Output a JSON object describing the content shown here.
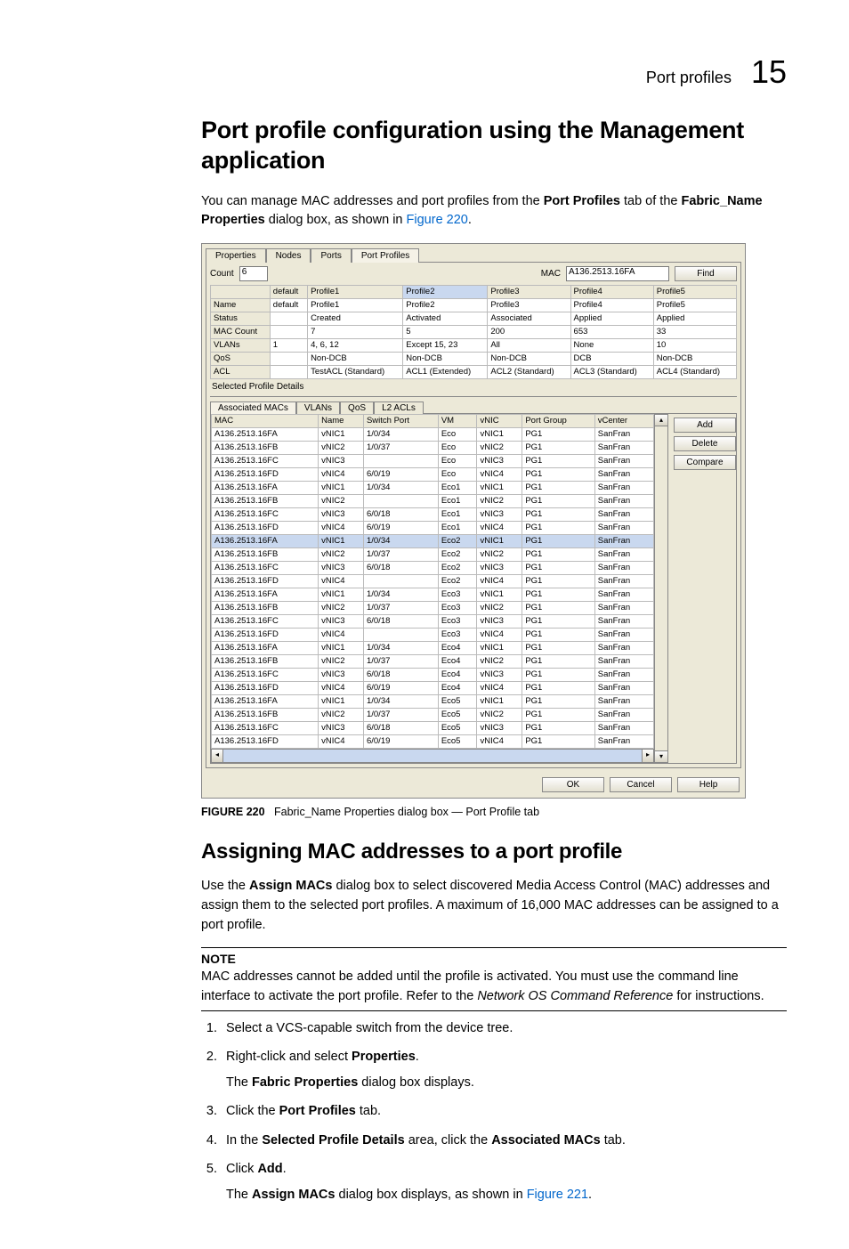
{
  "header": {
    "label": "Port profiles",
    "num": "15"
  },
  "h1": "Port profile configuration using the Management application",
  "intro": {
    "t1": "You can manage MAC addresses and port profiles from the ",
    "b1": "Port Profiles",
    "t2": " tab of the ",
    "b2": "Fabric_Name Properties",
    "t3": " dialog box, as shown in ",
    "link": "Figure 220",
    "t4": "."
  },
  "fig": {
    "mainTabs": [
      "Properties",
      "Nodes",
      "Ports",
      "Port Profiles"
    ],
    "activeMainTab": 3,
    "countLabel": "Count",
    "countVal": "6",
    "macLabel": "MAC",
    "macVal": "A136.2513.16FA",
    "findBtn": "Find",
    "summaryHeaders": [
      "",
      "default",
      "Profile1",
      "Profile2",
      "Profile3",
      "Profile4",
      "Profile5"
    ],
    "summaryRows": [
      [
        "Name",
        "default",
        "Profile1",
        "Profile2",
        "Profile3",
        "Profile4",
        "Profile5"
      ],
      [
        "Status",
        "",
        "Created",
        "Activated",
        "Associated",
        "Applied",
        "Applied"
      ],
      [
        "MAC Count",
        "",
        "7",
        "5",
        "200",
        "653",
        "33"
      ],
      [
        "VLANs",
        "1",
        "4, 6, 12",
        "Except 15, 23",
        "All",
        "None",
        "10"
      ],
      [
        "QoS",
        "",
        "Non-DCB",
        "Non-DCB",
        "Non-DCB",
        "DCB",
        "Non-DCB"
      ],
      [
        "ACL",
        "",
        "TestACL (Standard)",
        "ACL1 (Extended)",
        "ACL2 (Standard)",
        "ACL3 (Standard)",
        "ACL4 (Standard)"
      ]
    ],
    "detailsTitle": "Selected Profile Details",
    "subTabs": [
      "Associated MACs",
      "VLANs",
      "QoS",
      "L2 ACLs"
    ],
    "activeSubTab": 0,
    "detailHeaders": [
      "MAC",
      "Name",
      "Switch Port",
      "VM",
      "vNIC",
      "Port Group",
      "vCenter"
    ],
    "detailRows": [
      [
        "A136.2513.16FA",
        "vNIC1",
        "1/0/34",
        "Eco",
        "vNIC1",
        "PG1",
        "SanFran"
      ],
      [
        "A136.2513.16FB",
        "vNIC2",
        "1/0/37",
        "Eco",
        "vNIC2",
        "PG1",
        "SanFran"
      ],
      [
        "A136.2513.16FC",
        "vNIC3",
        "",
        "Eco",
        "vNIC3",
        "PG1",
        "SanFran"
      ],
      [
        "A136.2513.16FD",
        "vNIC4",
        "6/0/19",
        "Eco",
        "vNIC4",
        "PG1",
        "SanFran"
      ],
      [
        "A136.2513.16FA",
        "vNIC1",
        "1/0/34",
        "Eco1",
        "vNIC1",
        "PG1",
        "SanFran"
      ],
      [
        "A136.2513.16FB",
        "vNIC2",
        "",
        "Eco1",
        "vNIC2",
        "PG1",
        "SanFran"
      ],
      [
        "A136.2513.16FC",
        "vNIC3",
        "6/0/18",
        "Eco1",
        "vNIC3",
        "PG1",
        "SanFran"
      ],
      [
        "A136.2513.16FD",
        "vNIC4",
        "6/0/19",
        "Eco1",
        "vNIC4",
        "PG1",
        "SanFran"
      ],
      [
        "A136.2513.16FA",
        "vNIC1",
        "1/0/34",
        "Eco2",
        "vNIC1",
        "PG1",
        "SanFran"
      ],
      [
        "A136.2513.16FB",
        "vNIC2",
        "1/0/37",
        "Eco2",
        "vNIC2",
        "PG1",
        "SanFran"
      ],
      [
        "A136.2513.16FC",
        "vNIC3",
        "6/0/18",
        "Eco2",
        "vNIC3",
        "PG1",
        "SanFran"
      ],
      [
        "A136.2513.16FD",
        "vNIC4",
        "",
        "Eco2",
        "vNIC4",
        "PG1",
        "SanFran"
      ],
      [
        "A136.2513.16FA",
        "vNIC1",
        "1/0/34",
        "Eco3",
        "vNIC1",
        "PG1",
        "SanFran"
      ],
      [
        "A136.2513.16FB",
        "vNIC2",
        "1/0/37",
        "Eco3",
        "vNIC2",
        "PG1",
        "SanFran"
      ],
      [
        "A136.2513.16FC",
        "vNIC3",
        "6/0/18",
        "Eco3",
        "vNIC3",
        "PG1",
        "SanFran"
      ],
      [
        "A136.2513.16FD",
        "vNIC4",
        "",
        "Eco3",
        "vNIC4",
        "PG1",
        "SanFran"
      ],
      [
        "A136.2513.16FA",
        "vNIC1",
        "1/0/34",
        "Eco4",
        "vNIC1",
        "PG1",
        "SanFran"
      ],
      [
        "A136.2513.16FB",
        "vNIC2",
        "1/0/37",
        "Eco4",
        "vNIC2",
        "PG1",
        "SanFran"
      ],
      [
        "A136.2513.16FC",
        "vNIC3",
        "6/0/18",
        "Eco4",
        "vNIC3",
        "PG1",
        "SanFran"
      ],
      [
        "A136.2513.16FD",
        "vNIC4",
        "6/0/19",
        "Eco4",
        "vNIC4",
        "PG1",
        "SanFran"
      ],
      [
        "A136.2513.16FA",
        "vNIC1",
        "1/0/34",
        "Eco5",
        "vNIC1",
        "PG1",
        "SanFran"
      ],
      [
        "A136.2513.16FB",
        "vNIC2",
        "1/0/37",
        "Eco5",
        "vNIC2",
        "PG1",
        "SanFran"
      ],
      [
        "A136.2513.16FC",
        "vNIC3",
        "6/0/18",
        "Eco5",
        "vNIC3",
        "PG1",
        "SanFran"
      ],
      [
        "A136.2513.16FD",
        "vNIC4",
        "6/0/19",
        "Eco5",
        "vNIC4",
        "PG1",
        "SanFran"
      ]
    ],
    "selRow": 8,
    "sideBtns": [
      "Add",
      "Delete",
      "Compare"
    ],
    "footBtns": [
      "OK",
      "Cancel",
      "Help"
    ]
  },
  "caption": {
    "b": "FIGURE 220",
    "t": "Fabric_Name Properties dialog box — Port Profile tab"
  },
  "h2": "Assigning MAC addresses to a port profile",
  "p2": {
    "t1": "Use the ",
    "b1": "Assign MACs",
    "t2": " dialog box to select discovered Media Access Control (MAC) addresses and assign them to the selected port profiles. A maximum of 16,000 MAC addresses can be assigned to a port profile."
  },
  "note": {
    "head": "NOTE",
    "t1": "MAC addresses cannot be added until the profile is activated. You must use the command line interface to activate the port profile. Refer to the ",
    "i": "Network OS Command Reference",
    "t2": " for instructions."
  },
  "steps": [
    {
      "t": "Select a VCS-capable switch from the device tree."
    },
    {
      "t1": "Right-click and select ",
      "b": "Properties",
      "t2": ".",
      "sub": {
        "t1": "The ",
        "b": "Fabric Properties",
        "t2": " dialog box displays."
      }
    },
    {
      "t1": "Click the ",
      "b": "Port Profiles",
      "t2": " tab."
    },
    {
      "t1": "In the ",
      "b": "Selected Profile Details",
      "t2": " area, click the ",
      "b2": "Associated MACs",
      "t3": " tab."
    },
    {
      "t1": "Click ",
      "b": "Add",
      "t2": ".",
      "sub": {
        "t1": "The ",
        "b": "Assign MACs",
        "t2": " dialog box displays, as shown in ",
        "link": "Figure 221",
        "t3": "."
      }
    }
  ]
}
